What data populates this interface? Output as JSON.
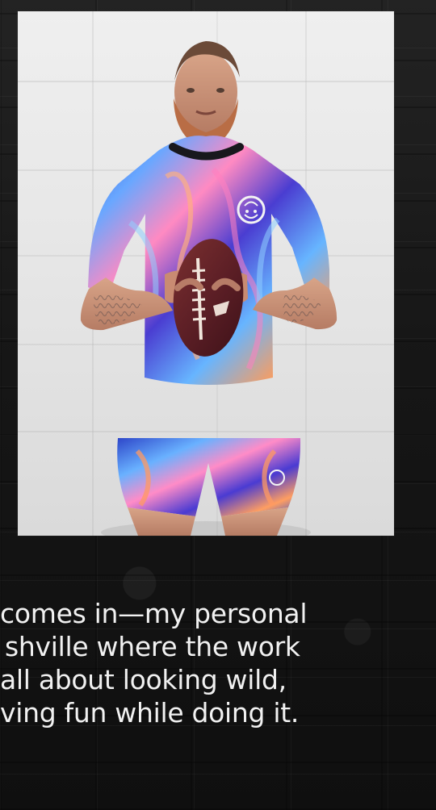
{
  "caption": {
    "lines": [
      "comes in—my personal",
      "shville where the work",
      "all about looking wild,",
      "ving fun while doing it."
    ]
  }
}
